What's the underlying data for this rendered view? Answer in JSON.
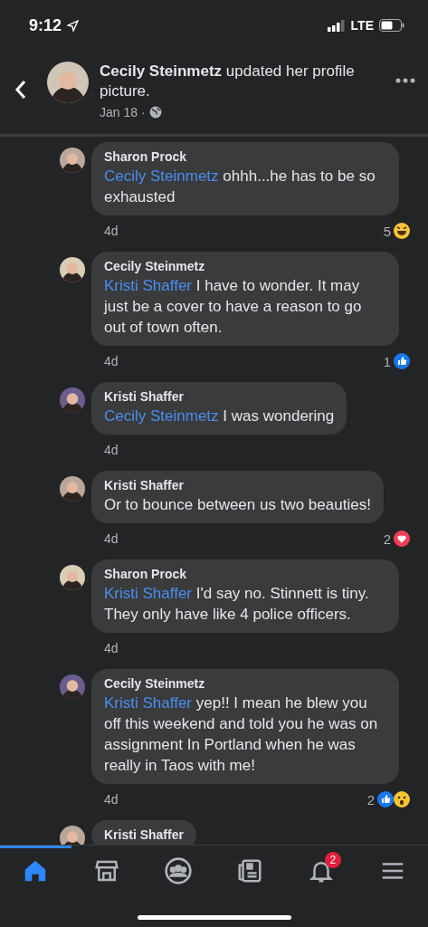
{
  "status_bar": {
    "time": "9:12",
    "network": "LTE"
  },
  "post_header": {
    "author": "Cecily Steinmetz",
    "action": "updated her profile picture.",
    "date": "Jan 18 ·"
  },
  "comments": [
    {
      "author": "Sharon Prock",
      "mention": "Cecily Steinmetz",
      "text": "ohhh...he has to be so exhausted",
      "time": "4d",
      "reaction_count": "5",
      "reactions": [
        {
          "kind": "haha"
        }
      ]
    },
    {
      "author": "Cecily Steinmetz",
      "mention": "Kristi Shaffer",
      "text": "I have to wonder. It may just be a cover to have a reason to go out of town often.",
      "time": "4d",
      "reaction_count": "1",
      "reactions": [
        {
          "kind": "like"
        }
      ]
    },
    {
      "author": "Kristi Shaffer",
      "mention": "Cecily Steinmetz",
      "text": "I was wondering",
      "time": "4d"
    },
    {
      "author": "Kristi Shaffer",
      "text": "Or to bounce between us two beauties!",
      "time": "4d",
      "reaction_count": "2",
      "reactions": [
        {
          "kind": "love"
        }
      ]
    },
    {
      "author": "Sharon Prock",
      "mention": "Kristi Shaffer",
      "text": "I'd say no. Stinnett is tiny. They only have like 4 police officers.",
      "time": "4d"
    },
    {
      "author": "Cecily Steinmetz",
      "mention": "Kristi Shaffer",
      "text": "yep!! I mean he blew you off this weekend and told you he was on assignment In Portland when he was really in Taos with me!",
      "time": "4d",
      "reaction_count": "2",
      "reactions": [
        {
          "kind": "like"
        },
        {
          "kind": "wow"
        }
      ]
    },
    {
      "author": "Kristi Shaffer"
    }
  ],
  "tab_bar": [
    {
      "kind": "home",
      "selected": true
    },
    {
      "kind": "marketplace",
      "selected": false
    },
    {
      "kind": "groups",
      "selected": false
    },
    {
      "kind": "news",
      "selected": false
    },
    {
      "kind": "notifications",
      "selected": false,
      "badge": "2"
    },
    {
      "kind": "menu",
      "selected": false
    }
  ]
}
